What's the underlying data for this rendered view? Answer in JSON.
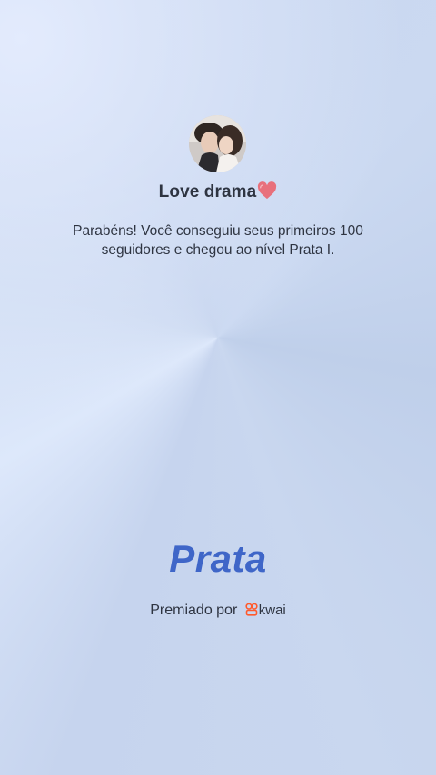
{
  "profile": {
    "name": "Love drama",
    "emoji": "❤️",
    "avatar_icon": "couple-photo-avatar"
  },
  "message": "Parabéns! Você conseguiu seus primeiros 100 seguidores e chegou ao nível Prata I.",
  "level": {
    "name": "Prata",
    "color": "#3f66c8"
  },
  "award": {
    "prefix": "Premiado por",
    "brand": "kwai",
    "brand_icon": "kwai-logo-icon",
    "brand_icon_color": "#ff5a2c"
  }
}
